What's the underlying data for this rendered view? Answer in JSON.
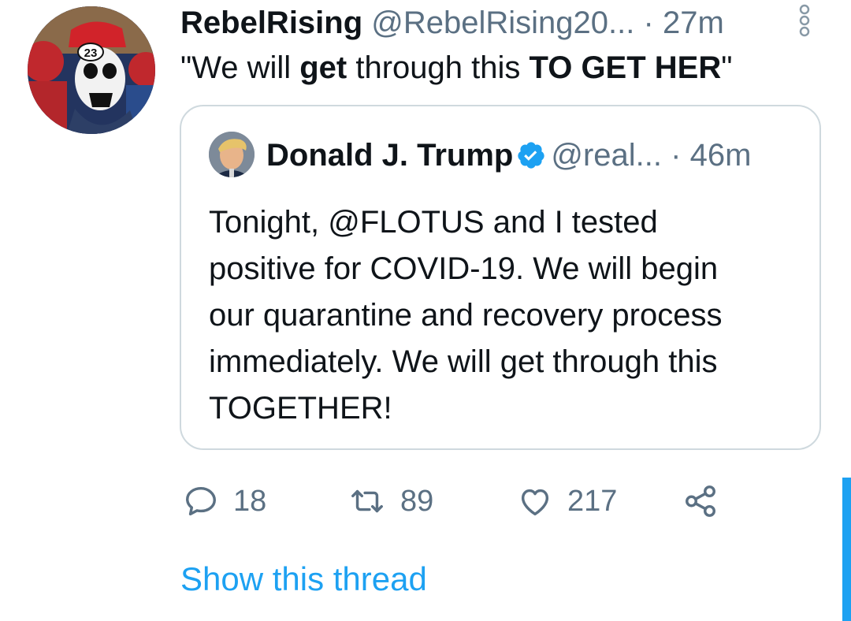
{
  "tweet": {
    "display_name": "RebelRising",
    "handle": "@RebelRising20...",
    "separator": "·",
    "time": "27m",
    "avatar_badge": "23",
    "text_parts": [
      {
        "text": "\"We will ",
        "bold": false
      },
      {
        "text": "get",
        "bold": true
      },
      {
        "text": " through this ",
        "bold": false
      },
      {
        "text": "TO GET HER",
        "bold": true
      },
      {
        "text": "\"",
        "bold": false
      }
    ],
    "more_icon": "more-vertical-icon"
  },
  "quote": {
    "display_name": "Donald J. Trump",
    "verified_icon": "verified-badge-icon",
    "handle": "@real...",
    "separator": "·",
    "time": "46m",
    "text_lines": [
      "Tonight, @FLOTUS and I tested",
      "positive for COVID-19. We will begin",
      "our quarantine and recovery process",
      "immediately. We will get through this",
      "TOGETHER!"
    ]
  },
  "actions": {
    "reply": {
      "icon": "reply-icon",
      "count": "18"
    },
    "retweet": {
      "icon": "retweet-icon",
      "count": "89"
    },
    "like": {
      "icon": "heart-icon",
      "count": "217"
    },
    "share": {
      "icon": "share-icon"
    }
  },
  "show_thread": "Show this thread",
  "colors": {
    "text_primary": "#0f1419",
    "text_secondary": "#5b7083",
    "accent": "#1da1f2",
    "border": "#cfd9de",
    "verified": "#1da1f2"
  }
}
